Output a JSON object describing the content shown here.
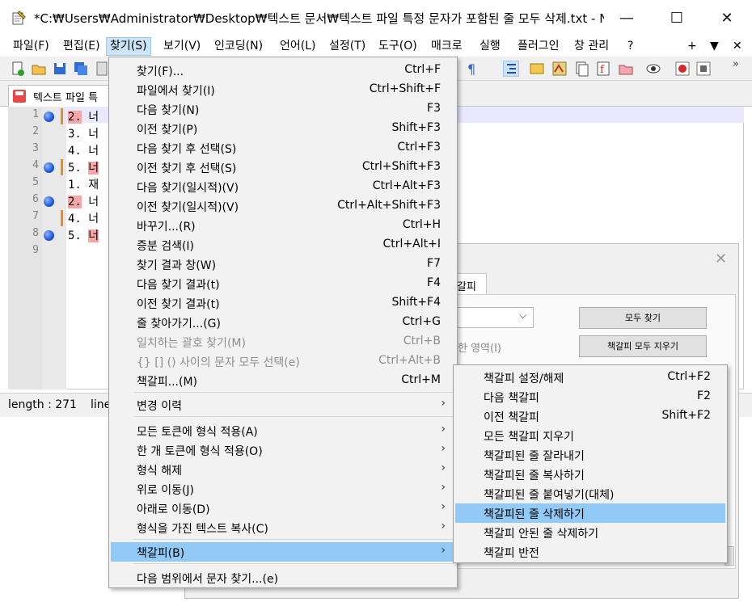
{
  "window": {
    "title": "*C:₩Users₩Administrator₩Desktop₩텍스트 문서₩텍스트 파일 특정 문자가 포함된 줄 모두 삭제.txt - N...",
    "minimize": "—",
    "maximize": "☐",
    "close": "✕"
  },
  "menubar": {
    "items": [
      "파일(F)",
      "편집(E)",
      "찾기(S)",
      "보기(V)",
      "인코딩(N)",
      "언어(L)",
      "설정(T)",
      "도구(O)",
      "매크로",
      "실행",
      "플러그인",
      "창 관리",
      "?"
    ],
    "right": [
      "+",
      "▼",
      "✕"
    ]
  },
  "toolbar": {
    "overflow": "»"
  },
  "tab": {
    "label": "텍스트 파일 특"
  },
  "editor": {
    "lines": [
      {
        "n": "1",
        "num": "2.",
        "text": "너"
      },
      {
        "n": "2",
        "num": "3.",
        "text": "너"
      },
      {
        "n": "3",
        "num": "4.",
        "text": "너"
      },
      {
        "n": "4",
        "num": "5.",
        "text": "너"
      },
      {
        "n": "5",
        "num": "1.",
        "text": "재"
      },
      {
        "n": "6",
        "num": "2.",
        "text": "너"
      },
      {
        "n": "7",
        "num": "4.",
        "text": "너"
      },
      {
        "n": "8",
        "num": "5.",
        "text": "너"
      },
      {
        "n": "9",
        "num": "",
        "text": ""
      }
    ]
  },
  "status": {
    "length": "length : 271",
    "line": "line"
  },
  "dialog": {
    "tab": "갈피",
    "find_all": "모두 찾기",
    "clear_bookmarks": "책갈피 모두 지우기",
    "area_label": "한 영역(I)"
  },
  "search_menu": {
    "items": [
      {
        "label": "찾기(F)...",
        "shortcut": "Ctrl+F"
      },
      {
        "label": "파일에서 찾기(I)",
        "shortcut": "Ctrl+Shift+F"
      },
      {
        "label": "다음 찾기(N)",
        "shortcut": "F3"
      },
      {
        "label": "이전 찾기(P)",
        "shortcut": "Shift+F3"
      },
      {
        "label": "다음 찾기 후 선택(S)",
        "shortcut": "Ctrl+F3"
      },
      {
        "label": "이전 찾기 후 선택(S)",
        "shortcut": "Ctrl+Shift+F3"
      },
      {
        "label": "다음 찾기(일시적)(V)",
        "shortcut": "Ctrl+Alt+F3"
      },
      {
        "label": "이전 찾기(일시적)(V)",
        "shortcut": "Ctrl+Alt+Shift+F3"
      },
      {
        "label": "바꾸기...(R)",
        "shortcut": "Ctrl+H"
      },
      {
        "label": "증분 검색(I)",
        "shortcut": "Ctrl+Alt+I"
      },
      {
        "label": "찾기 결과 창(W)",
        "shortcut": "F7"
      },
      {
        "label": "다음 찾기 결과(t)",
        "shortcut": "F4"
      },
      {
        "label": "이전 찾기 결과(t)",
        "shortcut": "Shift+F4"
      },
      {
        "label": "줄 찾아가기...(G)",
        "shortcut": "Ctrl+G"
      },
      {
        "label": "일치하는 괄호 찾기(M)",
        "shortcut": "Ctrl+B"
      },
      {
        "label": "{} [] () 사이의 문자 모두 선택(e)",
        "shortcut": "Ctrl+Alt+B"
      },
      {
        "label": "책갈피...(M)",
        "shortcut": "Ctrl+M"
      },
      {
        "label": "변경 이력",
        "shortcut": ""
      },
      {
        "label": "모든 토큰에 형식 적용(A)",
        "shortcut": ""
      },
      {
        "label": "한 개 토큰에 형식 적용(O)",
        "shortcut": ""
      },
      {
        "label": "형식 해제",
        "shortcut": ""
      },
      {
        "label": "위로 이동(J)",
        "shortcut": ""
      },
      {
        "label": "아래로 이동(D)",
        "shortcut": ""
      },
      {
        "label": "형식을 가진 텍스트 복사(C)",
        "shortcut": ""
      },
      {
        "label": "책갈피(B)",
        "shortcut": ""
      },
      {
        "label": "다음 범위에서 문자 찾기...(e)",
        "shortcut": ""
      }
    ],
    "submenu_arrow": "›"
  },
  "bookmark_menu": {
    "items": [
      {
        "label": "책갈피 설정/해제",
        "shortcut": "Ctrl+F2"
      },
      {
        "label": "다음 책갈피",
        "shortcut": "F2"
      },
      {
        "label": "이전 책갈피",
        "shortcut": "Shift+F2"
      },
      {
        "label": "모든 책갈피 지우기",
        "shortcut": ""
      },
      {
        "label": "책갈피된 줄 잘라내기",
        "shortcut": ""
      },
      {
        "label": "책갈피된 줄 복사하기",
        "shortcut": ""
      },
      {
        "label": "책갈피된 줄 붙여넣기(대체)",
        "shortcut": ""
      },
      {
        "label": "책갈피된 줄 삭제하기",
        "shortcut": ""
      },
      {
        "label": "책갈피 안된 줄 삭제하기",
        "shortcut": ""
      },
      {
        "label": "책갈피 반전",
        "shortcut": ""
      }
    ]
  },
  "colors": {
    "menu_highlight": "#91c9f7",
    "menubar_active": "#cce4f7",
    "bookmark_blue": "#1f57d6",
    "change_orange": "#f08a24",
    "match_pink": "#f5a6a6"
  }
}
